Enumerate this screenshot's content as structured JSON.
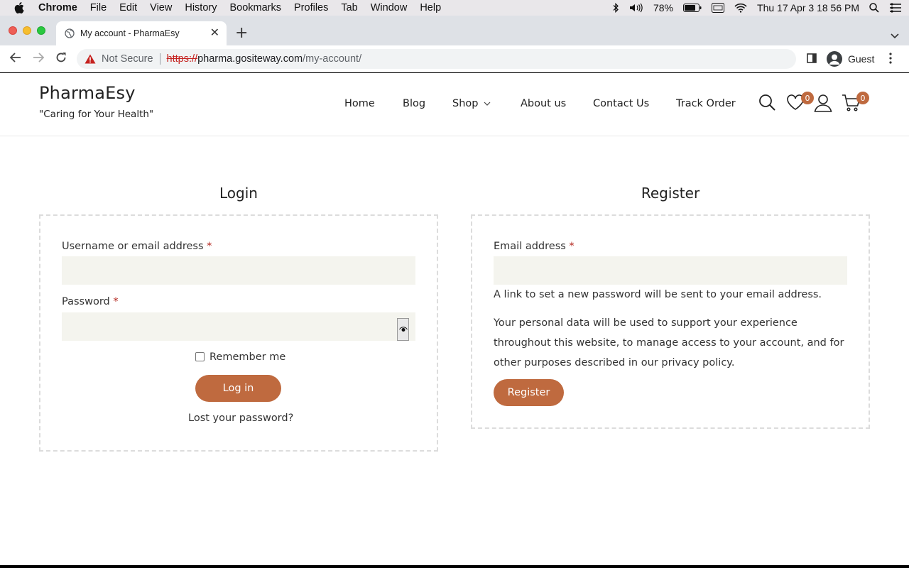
{
  "os_menubar": {
    "app": "Chrome",
    "items": [
      "File",
      "Edit",
      "View",
      "History",
      "Bookmarks",
      "Profiles",
      "Tab",
      "Window",
      "Help"
    ],
    "battery": "78%",
    "datetime": "Thu 17 Apr  3 18 56 PM"
  },
  "browser": {
    "tab_title": "My account - PharmaEsy",
    "security_label": "Not Secure",
    "url_scheme": "https://",
    "url_host": "pharma.gositeway.com",
    "url_path": "/my-account/",
    "profile_name": "Guest"
  },
  "site": {
    "brand": "PharmaEsy",
    "tagline": "\"Caring for Your Health\"",
    "nav": [
      "Home",
      "Blog",
      "Shop",
      "About us",
      "Contact Us",
      "Track Order"
    ],
    "wishlist_count": "0",
    "cart_count": "0"
  },
  "login": {
    "title": "Login",
    "username_label": "Username or email address",
    "password_label": "Password",
    "required_mark": "*",
    "remember_label": "Remember me",
    "submit_label": "Log in",
    "lost_password": "Lost your password?"
  },
  "register": {
    "title": "Register",
    "email_label": "Email address",
    "required_mark": "*",
    "notice": "A link to set a new password will be sent to your email address.",
    "privacy_text": "Your personal data will be used to support your experience throughout this website, to manage access to your account, and for other purposes described in our",
    "privacy_link": "privacy policy",
    "privacy_end": ".",
    "submit_label": "Register"
  },
  "colors": {
    "accent": "#bf6a3f",
    "field_bg": "#f4f4ee"
  }
}
